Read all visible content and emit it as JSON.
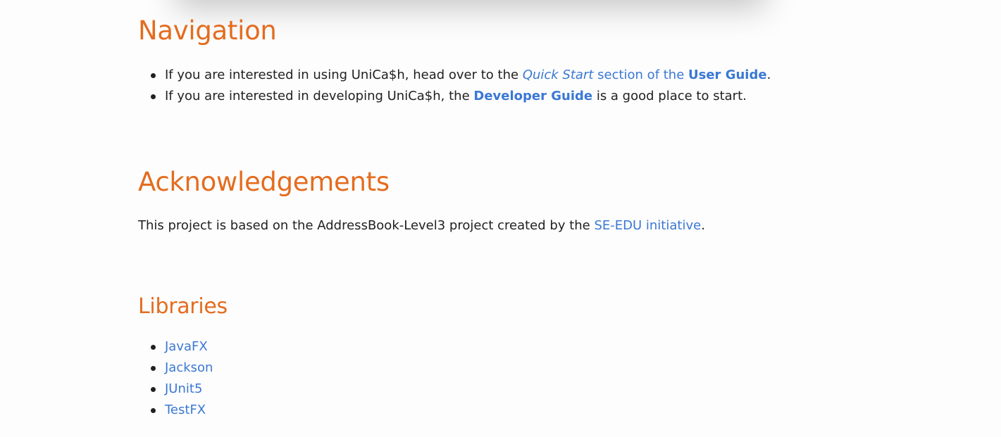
{
  "navigation": {
    "heading": "Navigation",
    "items": [
      {
        "prefix": "If you are interested in using UniCa$h, head over to the ",
        "link_italic": "Quick Start",
        "link_mid": " section of the ",
        "link_bold": "User Guide",
        "suffix": "."
      },
      {
        "prefix": "If you are interested in developing UniCa$h, the ",
        "link_bold": "Developer Guide",
        "suffix": " is a good place to start."
      }
    ]
  },
  "acknowledgements": {
    "heading": "Acknowledgements",
    "text_prefix": "This project is based on the AddressBook-Level3 project created by the ",
    "link": "SE-EDU initiative",
    "text_suffix": "."
  },
  "libraries": {
    "heading": "Libraries",
    "items": [
      "JavaFX",
      "Jackson",
      "JUnit5",
      "TestFX"
    ]
  },
  "colors": {
    "heading": "#e46c1f",
    "link": "#3a78d4",
    "text": "#212121",
    "background": "#fdfdfd"
  }
}
